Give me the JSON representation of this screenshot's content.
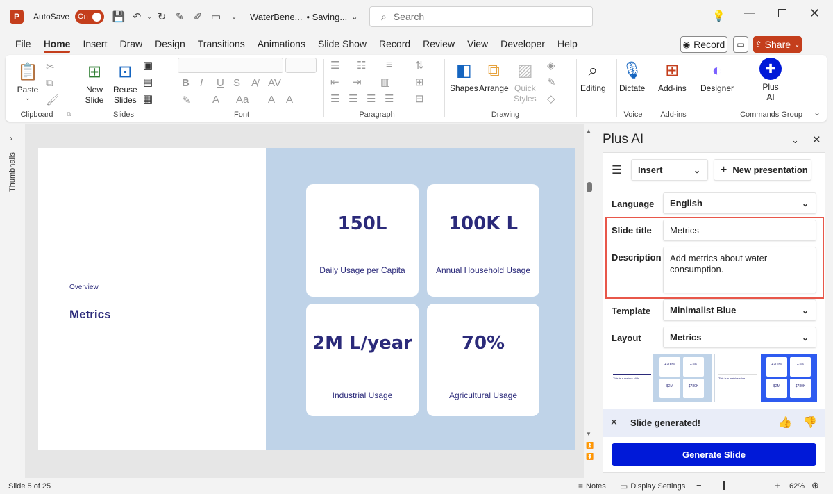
{
  "titlebar": {
    "app_logo": "P",
    "autosave_label": "AutoSave",
    "autosave_state": "On",
    "filename": "WaterBene...",
    "status": "• Saving...",
    "search_placeholder": "Search"
  },
  "tabs": [
    "File",
    "Home",
    "Insert",
    "Draw",
    "Design",
    "Transitions",
    "Animations",
    "Slide Show",
    "Record",
    "Review",
    "View",
    "Developer",
    "Help"
  ],
  "active_tab": "Home",
  "record_label": "Record",
  "share_label": "Share",
  "ribbon": {
    "paste": "Paste",
    "clipboard": "Clipboard",
    "new_slide_1": "New",
    "new_slide_2": "Slide",
    "reuse_1": "Reuse",
    "reuse_2": "Slides",
    "slides": "Slides",
    "font": "Font",
    "paragraph": "Paragraph",
    "shapes": "Shapes",
    "arrange": "Arrange",
    "quick_1": "Quick",
    "quick_2": "Styles",
    "drawing": "Drawing",
    "editing": "Editing",
    "dictate": "Dictate",
    "voice": "Voice",
    "addins_btn": "Add-ins",
    "addins": "Add-ins",
    "designer": "Designer",
    "plusai_1": "Plus",
    "plusai_2": "AI",
    "commands_group": "Commands Group"
  },
  "thumbnails_label": "Thumbnails",
  "slide": {
    "overview": "Overview",
    "title": "Metrics",
    "cards": [
      {
        "value": "150L",
        "label": "Daily Usage per Capita"
      },
      {
        "value": "100K L",
        "label": "Annual Household Usage"
      },
      {
        "value": "2M L/year",
        "label": "Industrial Usage"
      },
      {
        "value": "70%",
        "label": "Agricultural Usage"
      }
    ]
  },
  "panel": {
    "title": "Plus AI",
    "insert": "Insert",
    "new_presentation": "New presentation",
    "language_label": "Language",
    "language_value": "English",
    "slide_title_label": "Slide title",
    "slide_title_value": "Metrics",
    "description_label": "Description",
    "description_value": "Add metrics about water consumption.",
    "template_label": "Template",
    "template_value": "Minimalist Blue",
    "layout_label": "Layout",
    "layout_value": "Metrics",
    "thumb1": {
      "vals": [
        "+200%",
        "+3%",
        "$2M",
        "$780K"
      ],
      "title": "This is a metrics slide"
    },
    "thumb2": {
      "vals": [
        "+200%",
        "+3%",
        "$2M",
        "$780K"
      ],
      "title": "This is a metrics slide"
    },
    "generated": "Slide generated!",
    "generate_btn": "Generate Slide"
  },
  "status": {
    "slide_info": "Slide 5 of 25",
    "notes": "Notes",
    "display_settings": "Display Settings",
    "zoom": "62%"
  },
  "colors": {
    "accent": "#c43e1c",
    "primary_blue": "#0019d8",
    "highlight_border": "#e8574a",
    "slide_bg_right": "#bfd3e8",
    "slide_text": "#2b2a7a"
  }
}
